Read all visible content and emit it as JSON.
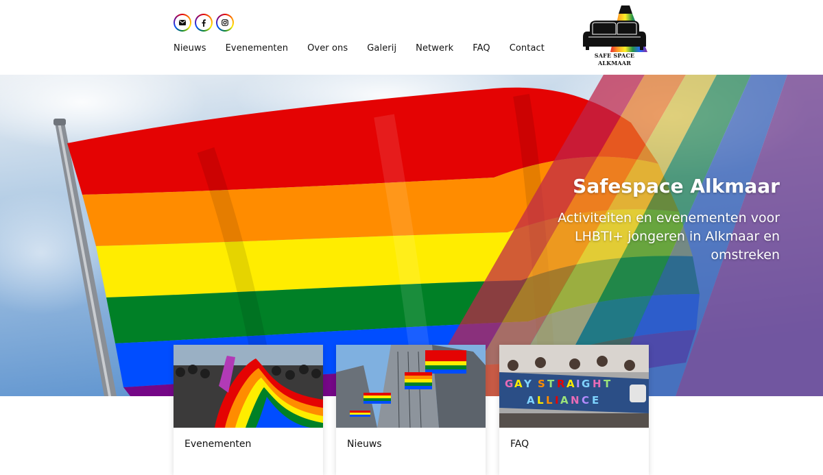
{
  "social": [
    {
      "icon": "email-icon",
      "label": "Email"
    },
    {
      "icon": "facebook-icon",
      "label": "Facebook"
    },
    {
      "icon": "instagram-icon",
      "label": "Instagram"
    }
  ],
  "nav": [
    "Nieuws",
    "Evenementen",
    "Over ons",
    "Galerij",
    "Netwerk",
    "FAQ",
    "Contact"
  ],
  "logo": {
    "line1": "SAFE SPACE",
    "line2": "ALKMAAR"
  },
  "hero": {
    "title": "Safespace Alkmaar",
    "subtitle": "Activiteiten en evenementen voor LHBTI+ jongeren in Alkmaar en omstreken"
  },
  "cards": [
    {
      "title": "Evenementen",
      "image": "pride-crowd-photo"
    },
    {
      "title": "Nieuws",
      "image": "rainbow-flags-skyscrapers-photo"
    },
    {
      "title": "FAQ",
      "image": "gay-straight-alliance-banner-photo"
    }
  ],
  "colors": {
    "rainbow": [
      "#e40303",
      "#ff8c00",
      "#ffed00",
      "#008026",
      "#004dff",
      "#750787"
    ],
    "sky": "#6fa3d6"
  }
}
